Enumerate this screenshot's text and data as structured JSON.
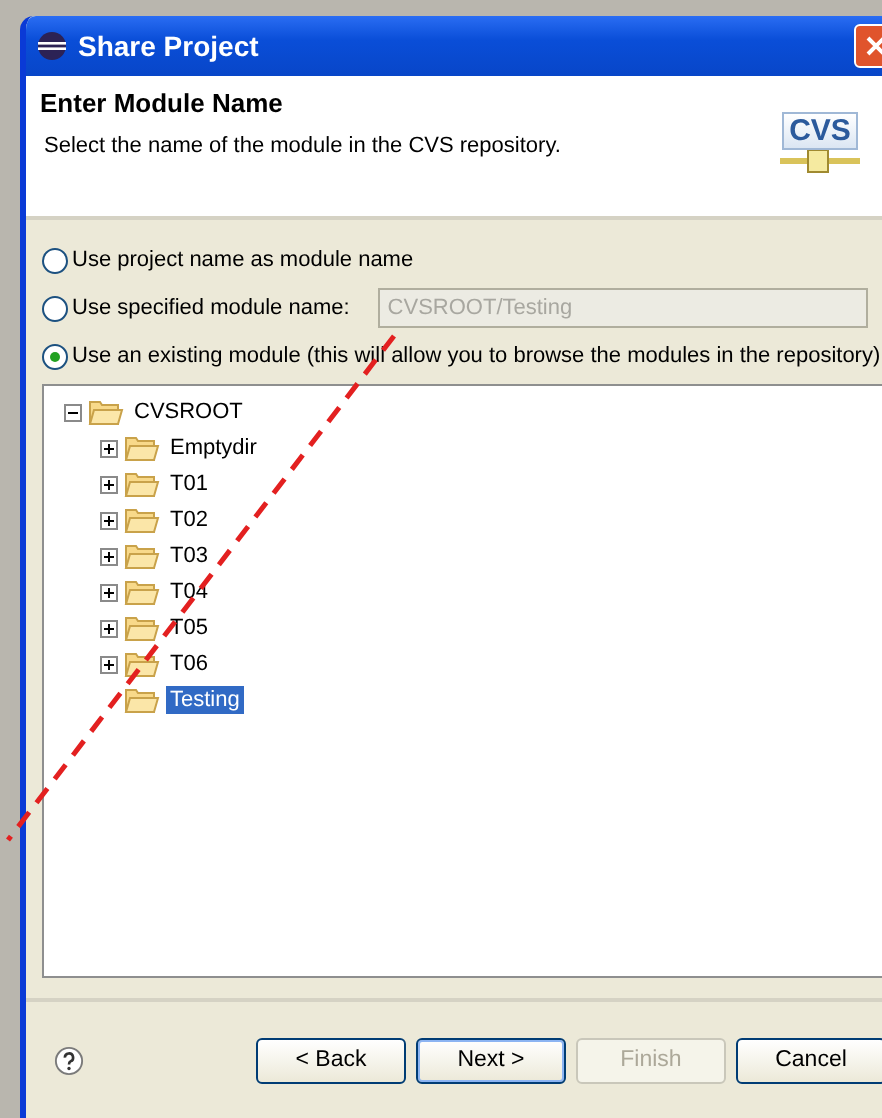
{
  "window": {
    "title": "Share Project"
  },
  "header": {
    "title": "Enter Module Name",
    "description": "Select the name of the module in the CVS repository.",
    "logo_text": "CVS"
  },
  "options": [
    {
      "label": "Use project name as module name",
      "selected": false
    },
    {
      "label": "Use specified module name:",
      "selected": false,
      "field": {
        "value": "CVSROOT/Testing",
        "disabled": true
      }
    },
    {
      "label": "Use an existing module (this will allow you to browse the modules in the repository)",
      "selected": true
    }
  ],
  "tree": [
    {
      "label": "CVSROOT",
      "expandable": true,
      "expanded": true,
      "selected": false,
      "children": [
        {
          "label": "Emptydir",
          "expandable": true,
          "expanded": false,
          "selected": false
        },
        {
          "label": "T01",
          "expandable": true,
          "expanded": false,
          "selected": false
        },
        {
          "label": "T02",
          "expandable": true,
          "expanded": false,
          "selected": false
        },
        {
          "label": "T03",
          "expandable": true,
          "expanded": false,
          "selected": false
        },
        {
          "label": "T04",
          "expandable": true,
          "expanded": false,
          "selected": false
        },
        {
          "label": "T05",
          "expandable": true,
          "expanded": false,
          "selected": false
        },
        {
          "label": "T06",
          "expandable": true,
          "expanded": false,
          "selected": false
        },
        {
          "label": "Testing",
          "selected": true
        }
      ]
    }
  ],
  "buttons": [
    {
      "label": "< Back",
      "disabled": false,
      "default": false
    },
    {
      "label": "Next >",
      "disabled": false,
      "default": true
    },
    {
      "label": "Finish",
      "disabled": true,
      "default": false
    },
    {
      "label": "Cancel",
      "disabled": false,
      "default": false
    }
  ]
}
